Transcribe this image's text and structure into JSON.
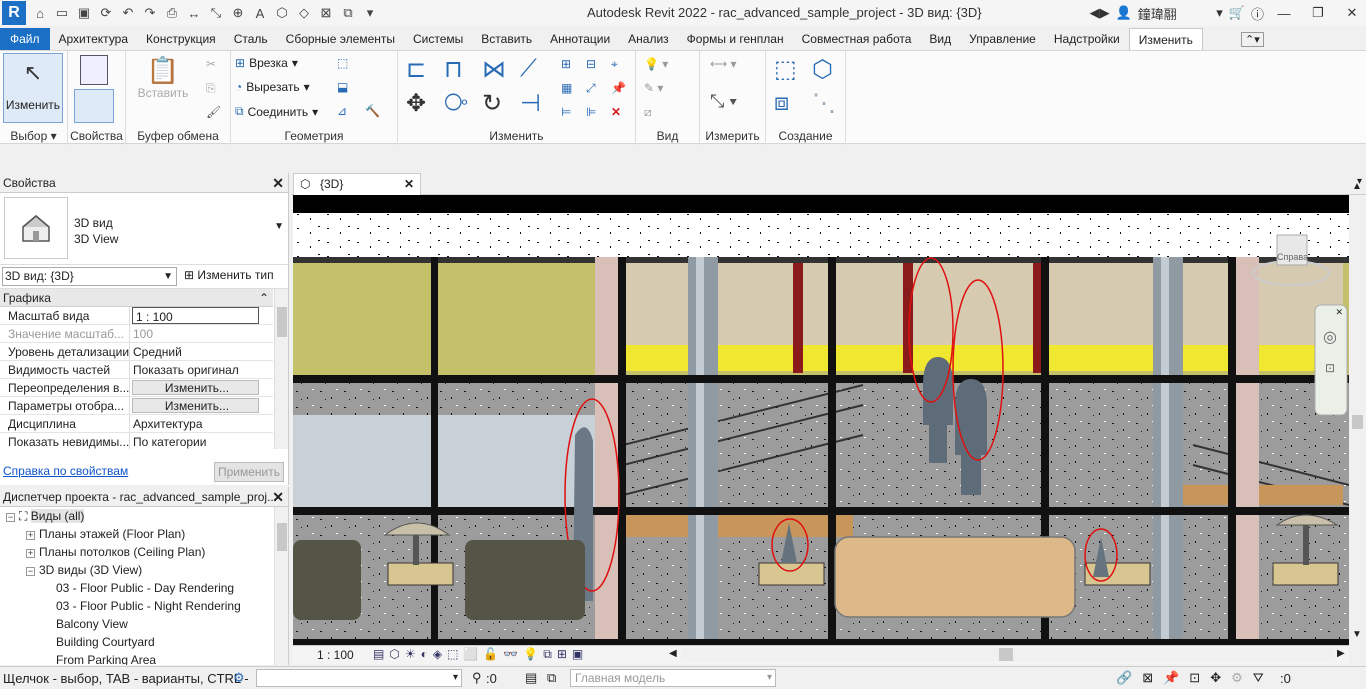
{
  "titlebar": {
    "logo": "R",
    "title": "Autodesk Revit 2022 - rac_advanced_sample_project - 3D вид: {3D}",
    "user": "鐘瑋翮"
  },
  "tabs": [
    "Файл",
    "Архитектура",
    "Конструкция",
    "Сталь",
    "Сборные элементы",
    "Системы",
    "Вставить",
    "Аннотации",
    "Анализ",
    "Формы и генплан",
    "Совместная работа",
    "Вид",
    "Управление",
    "Надстройки",
    "Изменить"
  ],
  "ribbon": {
    "modify_label": "Изменить",
    "select_label": "Выбор",
    "properties_label": "Свойства",
    "clipboard_label": "Буфер обмена",
    "paste_label": "Вставить",
    "geometry_label": "Геометрия",
    "cope_label": "Врезка",
    "cut_label": "Вырезать",
    "join_label": "Соединить",
    "modify_panel_label": "Изменить",
    "view_label": "Вид",
    "measure_label": "Измерить",
    "create_label": "Создание"
  },
  "properties": {
    "title": "Свойства",
    "type_line1": "3D вид",
    "type_line2": "3D View",
    "view_combo": "3D вид: {3D}",
    "edit_type": "Изменить тип",
    "group": "Графика",
    "rows": [
      {
        "name": "Масштаб вида",
        "value": "1 : 100"
      },
      {
        "name": "Значение масштаб...",
        "value": "100"
      },
      {
        "name": "Уровень детализации",
        "value": "Средний"
      },
      {
        "name": "Видимость частей",
        "value": "Показать оригинал"
      },
      {
        "name": "Переопределения в...",
        "value": "Изменить..."
      },
      {
        "name": "Параметры отобра...",
        "value": "Изменить..."
      },
      {
        "name": "Дисциплина",
        "value": "Архитектура"
      },
      {
        "name": "Показать невидимы...",
        "value": "По категории"
      }
    ],
    "help": "Справка по свойствам",
    "apply": "Применить"
  },
  "browser": {
    "title": "Диспетчер проекта - rac_advanced_sample_proj...",
    "items": [
      {
        "label": "Виды (all)",
        "level": 0,
        "toggle": "−"
      },
      {
        "label": "Планы этажей (Floor Plan)",
        "level": 1,
        "toggle": "+"
      },
      {
        "label": "Планы потолков (Ceiling Plan)",
        "level": 1,
        "toggle": "+"
      },
      {
        "label": "3D виды (3D View)",
        "level": 1,
        "toggle": "−"
      },
      {
        "label": "03 - Floor Public - Day Rendering",
        "level": 2,
        "toggle": ""
      },
      {
        "label": "03 - Floor Public - Night Rendering",
        "level": 2,
        "toggle": ""
      },
      {
        "label": "Balcony View",
        "level": 2,
        "toggle": ""
      },
      {
        "label": "Building Courtyard",
        "level": 2,
        "toggle": ""
      },
      {
        "label": "From Parking Area",
        "level": 2,
        "toggle": ""
      }
    ]
  },
  "view": {
    "tab_label": "{3D}",
    "scale": "1 : 100",
    "viewcube_label": "Справа"
  },
  "status": {
    "hint": "Щелчок - выбор, TAB - варианты, CTRL -",
    "filter_count": ":0",
    "model": "Главная модель",
    "selection_count": ":0"
  }
}
